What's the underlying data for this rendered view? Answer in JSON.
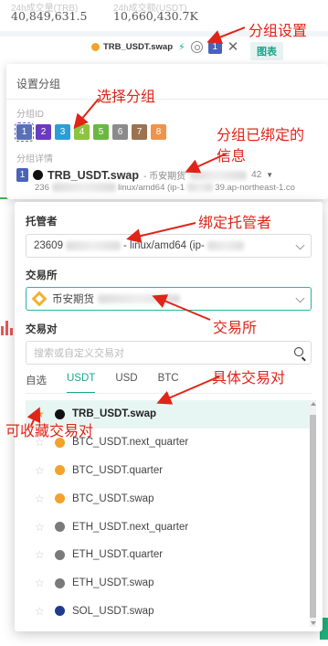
{
  "top_stats": {
    "left_label": "24h成交量(TRB)",
    "left_value": "40,849,631.5",
    "right_label": "24h成交额(USDT)",
    "right_value": "10,660,430.7K"
  },
  "group_bar": {
    "symbol": "TRB_USDT.swap",
    "group_badge": "1",
    "chart_button": "图表"
  },
  "settings": {
    "title": "设置分组",
    "group_id_label": "分组ID",
    "group_ids": [
      {
        "id": "1",
        "color": "#4a63b8"
      },
      {
        "id": "2",
        "color": "#6a3bbf"
      },
      {
        "id": "3",
        "color": "#2a9fd6"
      },
      {
        "id": "4",
        "color": "#8cc43f"
      },
      {
        "id": "5",
        "color": "#6ab842"
      },
      {
        "id": "6",
        "color": "#8b8b8b"
      },
      {
        "id": "7",
        "color": "#9c7350"
      },
      {
        "id": "8",
        "color": "#f0934a"
      }
    ],
    "detail_label": "分组详情",
    "bound": {
      "num": "1",
      "symbol": "TRB_USDT.swap",
      "exchange": "- 币安期货",
      "suffix": "42",
      "detail_left": "236",
      "detail_right": "linux/amd64 (ip-1",
      "detail_end": "39.ap-northeast-1.co"
    }
  },
  "form": {
    "custodian_label": "托管者",
    "custodian_value_prefix": "23609",
    "custodian_value_suffix": "- linux/amd64 (ip-",
    "exchange_label": "交易所",
    "exchange_value": "币安期货",
    "pair_label": "交易对",
    "search_placeholder": "搜索或自定义交易对",
    "tabs": [
      "自选",
      "USDT",
      "USD",
      "BTC"
    ],
    "active_tab": "USDT"
  },
  "pairs": [
    {
      "name": "TRB_USDT.swap",
      "fav": true,
      "icon_color": "#111111",
      "selected": true
    },
    {
      "name": "BTC_USDT.next_quarter",
      "fav": false,
      "icon_color": "#f3a329",
      "selected": false
    },
    {
      "name": "BTC_USDT.quarter",
      "fav": false,
      "icon_color": "#f3a329",
      "selected": false
    },
    {
      "name": "BTC_USDT.swap",
      "fav": false,
      "icon_color": "#f3a329",
      "selected": false
    },
    {
      "name": "ETH_USDT.next_quarter",
      "fav": false,
      "icon_color": "#7a7a7a",
      "selected": false
    },
    {
      "name": "ETH_USDT.quarter",
      "fav": false,
      "icon_color": "#7a7a7a",
      "selected": false
    },
    {
      "name": "ETH_USDT.swap",
      "fav": false,
      "icon_color": "#7a7a7a",
      "selected": false
    },
    {
      "name": "SOL_USDT.swap",
      "fav": false,
      "icon_color": "#1f3c8c",
      "selected": false
    }
  ],
  "annotations": {
    "group_settings": "分组设置",
    "select_group": "选择分组",
    "bound_info_line1": "分组已绑定的",
    "bound_info_line2": "信息",
    "bind_custodian": "绑定托管者",
    "exchange": "交易所",
    "specific_pair": "具体交易对",
    "favoritable": "可收藏交易对"
  }
}
